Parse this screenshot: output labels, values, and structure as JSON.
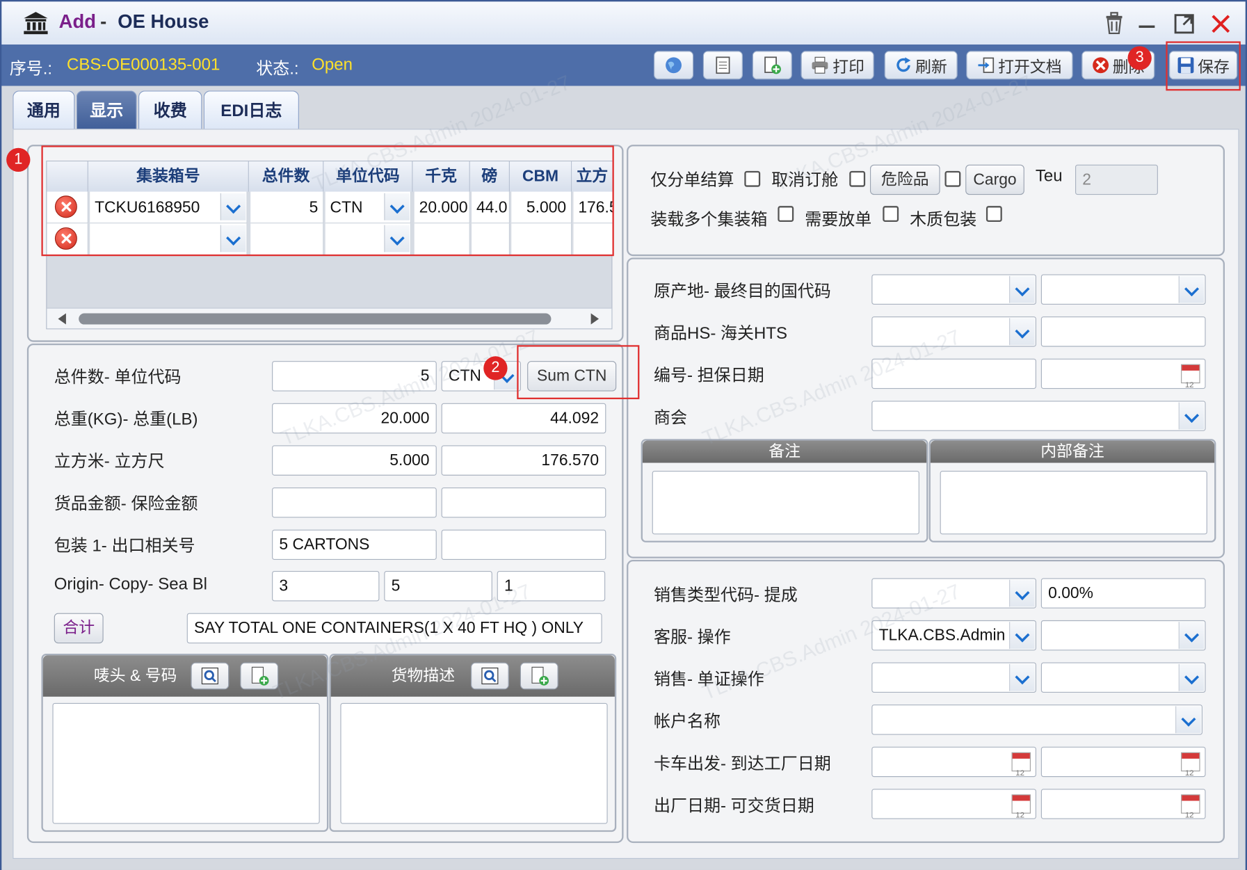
{
  "window": {
    "title_prefix": "Add",
    "title_sep": "-",
    "title": "OE House"
  },
  "toolbar": {
    "seq_label": "序号.:",
    "seq_value": "CBS-OE000135-001",
    "status_label": "状态.:",
    "status_value": "Open",
    "print": "打印",
    "refresh": "刷新",
    "open_doc": "打开文档",
    "delete": "删除",
    "save": "保存"
  },
  "tabs": [
    "通用",
    "显示",
    "收费",
    "EDI日志"
  ],
  "active_tab": "显示",
  "grid": {
    "columns": [
      "集装箱号",
      "总件数",
      "单位代码",
      "千克",
      "磅",
      "CBM",
      "立方"
    ],
    "rows": [
      {
        "container": "TCKU6168950",
        "pieces": "5",
        "unit": "CTN",
        "kg": "20.000",
        "lb": "44.0",
        "cbm": "5.000",
        "cft": "176.5"
      },
      {
        "container": "",
        "pieces": "",
        "unit": "",
        "kg": "",
        "lb": "",
        "cbm": "",
        "cft": ""
      }
    ]
  },
  "left_form": {
    "pieces_label": "总件数- 单位代码",
    "pieces_value": "5",
    "unit_value": "CTN",
    "sum_ctn": "Sum CTN",
    "weight_label": "总重(KG)- 总重(LB)",
    "kg_value": "20.000",
    "lb_value": "44.092",
    "volume_label": "立方米- 立方尺",
    "cbm_value": "5.000",
    "cft_value": "176.570",
    "amount_label": "货品金额- 保险金额",
    "package_label": "包装 1- 出口相关号",
    "package_value": "5 CARTONS",
    "origin_label": "Origin- Copy- Sea Bl",
    "origin_value": "3",
    "copy_value": "5",
    "seabl_value": "1",
    "total_button": "合计",
    "total_text": "SAY TOTAL ONE CONTAINERS(1 X 40 FT HQ ) ONLY",
    "marks_header": "唛头 & 号码",
    "desc_header": "货物描述"
  },
  "right_top": {
    "split_only": "仅分单结算",
    "cancel_booking": "取消订舱",
    "dangerous": "危险品",
    "cargo": "Cargo",
    "teu_label": "Teu",
    "teu_value": "2",
    "multi_container": "装载多个集装箱",
    "need_release": "需要放单",
    "wood_pack": "木质包装"
  },
  "right_mid": {
    "origin_dest": "原产地- 最终目的国代码",
    "hs_hts": "商品HS-  海关HTS",
    "no_guarantee": "编号- 担保日期",
    "chamber": "商会",
    "remark": "备注",
    "internal_remark": "内部备注"
  },
  "right_bottom": {
    "sales_type": "销售类型代码- 提成",
    "commission_value": "0.00%",
    "cs_ops": "客服- 操作",
    "cs_value": "TLKA.CBS.Admin",
    "sales_doc": "销售- 单证操作",
    "account_name": "帐户名称",
    "truck_dates": "卡车出发-  到达工厂日期",
    "factory_dates": "出厂日期- 可交货日期"
  },
  "badges": [
    "1",
    "2",
    "3"
  ],
  "watermark": "TLKA.CBS.Admin 2024-01-27",
  "colors": {
    "title_accent": "#7a1f8a",
    "toolbar_bg": "#4e6ea9",
    "status_yellow": "#ffe12a",
    "highlight_red": "#e03030",
    "dropdown_arrow": "#1b6fd0"
  }
}
